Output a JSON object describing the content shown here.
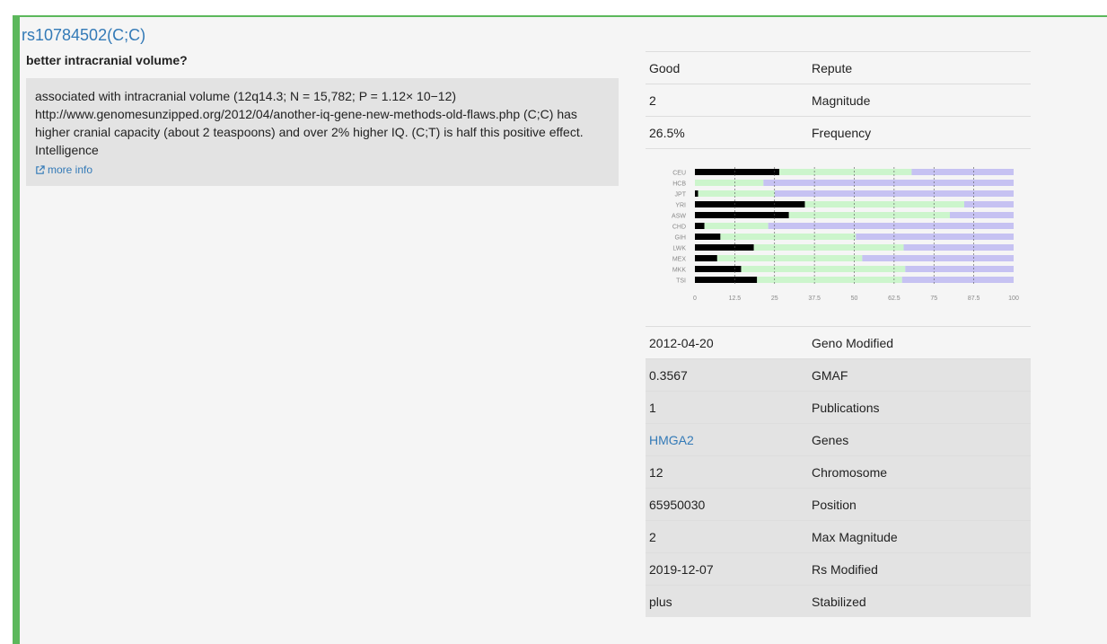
{
  "snp": {
    "title": "rs10784502(C;C)",
    "subtitle": "better intracranial volume?",
    "summary_lines": [
      "associated with intracranial volume (12q14.3; N = 15,782; P = 1.12× 10−12)",
      "http://www.genomesunzipped.org/2012/04/another-iq-gene-new-methods-old-flaws.php (C;C) has",
      "higher cranial capacity (about 2 teaspoons) and over 2% higher IQ. (C;T) is half this positive effect.",
      "Intelligence"
    ],
    "more_info": "more info"
  },
  "colors": {
    "accent": "#5cb85c",
    "link": "#337ab7",
    "bar_black": "#000000",
    "bar_green": "#ccf5cc",
    "bar_purple": "#c6c2f2"
  },
  "top_rows": [
    {
      "value": "Good",
      "key": "Repute"
    },
    {
      "value": "2",
      "key": "Magnitude"
    },
    {
      "value": "26.5%",
      "key": "Frequency"
    }
  ],
  "bottom_rows": [
    {
      "value": "2012-04-20",
      "key": "Geno Modified"
    },
    {
      "value": "0.3567",
      "key": "GMAF"
    },
    {
      "value": "1",
      "key": "Publications"
    },
    {
      "value": "HMGA2",
      "key": "Genes"
    },
    {
      "value": "12",
      "key": "Chromosome"
    },
    {
      "value": "65950030",
      "key": "Position"
    },
    {
      "value": "2",
      "key": "Max Magnitude"
    },
    {
      "value": "2019-12-07",
      "key": "Rs Modified"
    },
    {
      "value": "plus",
      "key": "Stabilized"
    }
  ],
  "chart_data": {
    "type": "bar",
    "stacked": true,
    "orientation": "horizontal",
    "categories": [
      "CEU",
      "HCB",
      "JPT",
      "YRI",
      "ASW",
      "CHD",
      "GIH",
      "LWK",
      "MEX",
      "MKK",
      "TSI"
    ],
    "series": [
      {
        "values": [
          26.5,
          0,
          1,
          34.5,
          29.5,
          3,
          8,
          18.5,
          7,
          14.5,
          19.5
        ]
      },
      {
        "values": [
          41.5,
          21.5,
          24,
          50,
          50.5,
          20,
          42.5,
          47,
          45.5,
          51.5,
          45.5
        ]
      },
      {
        "values": [
          32,
          78.5,
          75,
          15.5,
          20,
          77,
          49.5,
          34.5,
          47.5,
          34,
          35
        ]
      }
    ],
    "xticks": [
      "0",
      "12.5",
      "25",
      "37.5",
      "50",
      "62.5",
      "75",
      "87.5",
      "100"
    ],
    "xlim": [
      0,
      100
    ],
    "grid": true
  }
}
